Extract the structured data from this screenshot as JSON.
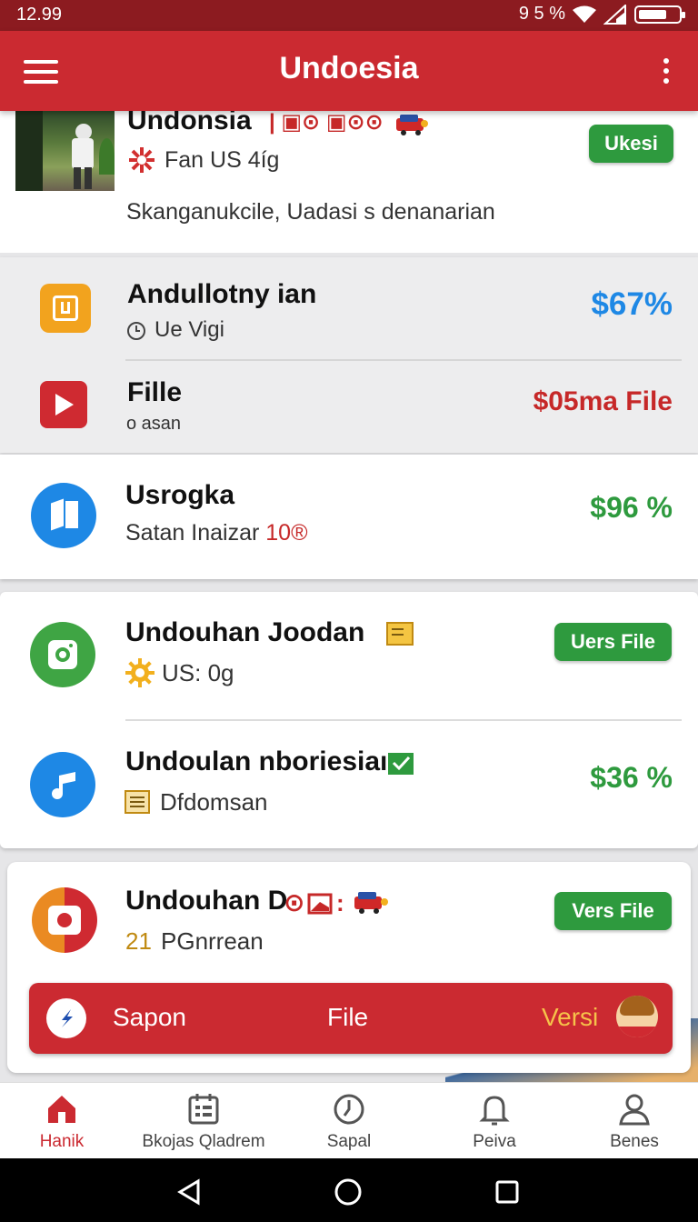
{
  "status_bar": {
    "time": "12.99",
    "indicators": "9 5 %"
  },
  "app_bar": {
    "title": "Undoesia",
    "menu_icon": "hamburger-icon",
    "overflow_icon": "more-vert-icon"
  },
  "top_card": {
    "title": "Undonsia",
    "title_suffix": "| ▣⊙ ▣⊙⊙",
    "meta": "Fan US 4íg",
    "description": "Skanganukcile, Uadasi s denanarian",
    "action_label": "Ukesi"
  },
  "list_group_1": [
    {
      "title": "Andullotny ian",
      "subtitle": "Ue Vigi",
      "value": "$67%",
      "value_color": "#1e88e5",
      "icon": "orange-app-icon"
    },
    {
      "title": "Fille",
      "subtitle": "o  asan",
      "value": "$05ma File",
      "value_color": "#c62828",
      "icon": "play-icon"
    }
  ],
  "single_item": {
    "title": "Usrogka",
    "subtitle": "Satan Inaizar",
    "subtitle_suffix": "10®",
    "value": "$96 %",
    "value_color": "#2e9a3e",
    "icon": "blue-app-icon"
  },
  "list_group_2": [
    {
      "title": "Undouhan Joodan",
      "subtitle": "US: 0g",
      "action_label": "Uers File",
      "icon": "camera-icon"
    },
    {
      "title": "Undoulan nboriesiaı",
      "subtitle": "Dfdomsan",
      "value": "$36 %",
      "value_color": "#2e9a3e",
      "icon": "music-note-icon"
    }
  ],
  "last_card": {
    "title": "Undouhan D",
    "title_suffix": "⊙",
    "subtitle_prefix": "21",
    "subtitle": "PGnrrean",
    "action_label": "Vers File",
    "icon": "record-icon",
    "banner": {
      "left_label": "Sapon",
      "center_label": "File",
      "right_label": "Versi",
      "icon": "compass-icon",
      "avatar": "avatar"
    }
  },
  "bottom_nav": [
    {
      "label": "Hanik",
      "icon": "home-icon",
      "active": true
    },
    {
      "label": "Bkojas Qladrem",
      "icon": "calendar-icon",
      "active": false
    },
    {
      "label": "Sapal",
      "icon": "clock-icon",
      "active": false
    },
    {
      "label": "Peiva",
      "icon": "bell-icon",
      "active": false
    },
    {
      "label": "Benes",
      "icon": "person-icon",
      "active": false
    }
  ],
  "colors": {
    "primary": "#cb2a31",
    "dark_primary": "#8c1b20",
    "green": "#2e9a3e",
    "blue": "#1e88e5",
    "red_text": "#c62828"
  }
}
